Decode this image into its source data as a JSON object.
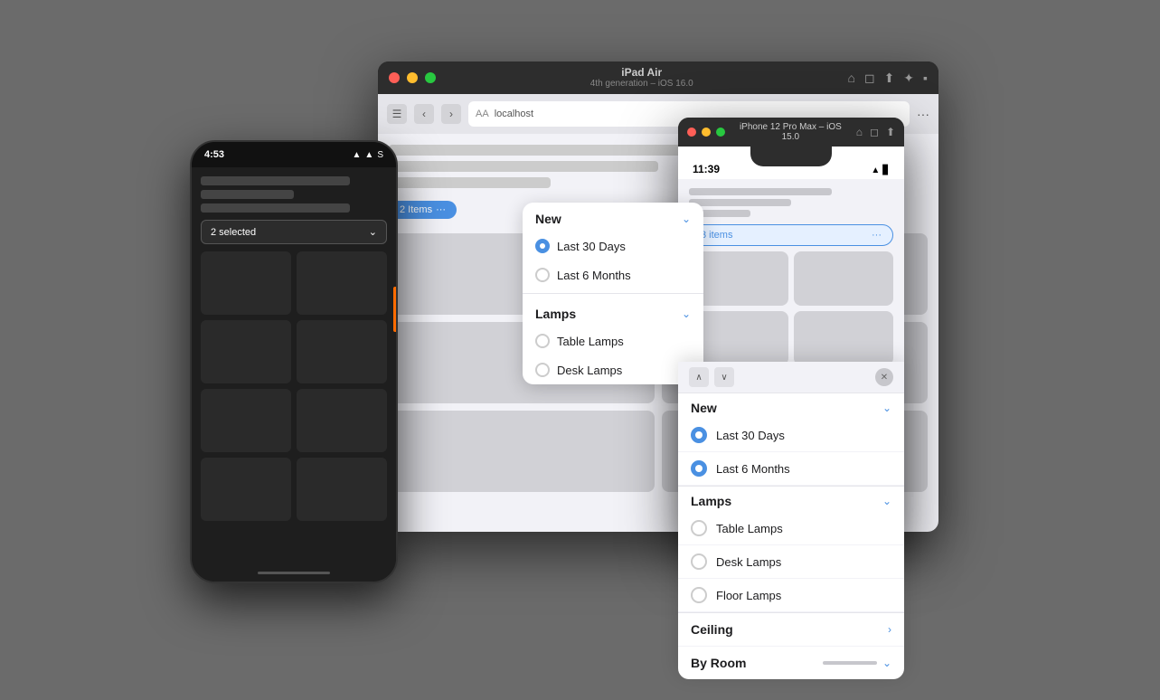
{
  "background": "#6b6b6b",
  "macWindow": {
    "title": "iPad Air",
    "subtitle": "4th generation – iOS 16.0",
    "dots": [
      "red",
      "yellow",
      "green"
    ],
    "browserUrl": "localhost",
    "browserAA": "AA",
    "itemsPill": "2 Items",
    "dropdown": {
      "section1Title": "New",
      "section1Items": [
        {
          "label": "Last 30 Days",
          "checked": true
        },
        {
          "label": "Last 6 Months",
          "checked": false
        }
      ],
      "section2Title": "Lamps",
      "section2Items": [
        {
          "label": "Table Lamps",
          "checked": false
        },
        {
          "label": "Desk Lamps",
          "checked": false
        }
      ]
    }
  },
  "androidPhone": {
    "time": "4:53",
    "statusIcons": "▲▲ S",
    "selectLabel": "2 selected",
    "gridCells": 8
  },
  "iphoneWindow": {
    "title": "iPhone 12 Pro Max – iOS 15.0",
    "dots": [
      "red",
      "yellow",
      "green"
    ],
    "phone": {
      "time": "11:39",
      "itemsPill": "3 items",
      "gridCells": 4
    },
    "dropdown": {
      "section1Title": "New",
      "section1Items": [
        {
          "label": "Last 30 Days",
          "checked": true
        },
        {
          "label": "Last 6 Months",
          "checked": true
        }
      ],
      "section2Title": "Lamps",
      "section2Items": [
        {
          "label": "Table Lamps",
          "checked": false
        },
        {
          "label": "Desk Lamps",
          "checked": false
        },
        {
          "label": "Floor Lamps",
          "checked": false
        }
      ],
      "section3Title": "Ceiling",
      "section4Title": "By Room"
    }
  }
}
